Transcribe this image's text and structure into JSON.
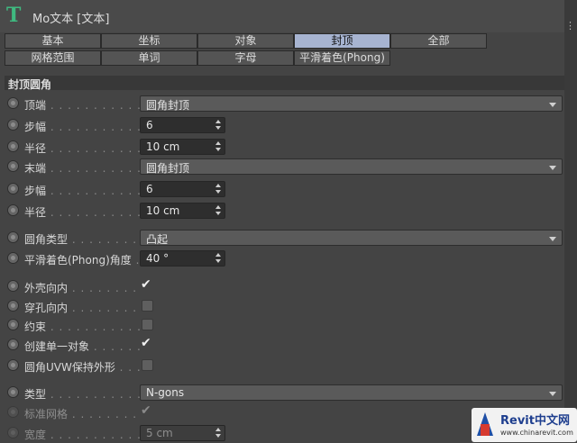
{
  "window": {
    "title": "Mo文本 [文本]",
    "icon": "text-t-icon"
  },
  "tabs_row1": [
    {
      "label": "基本",
      "active": false
    },
    {
      "label": "坐标",
      "active": false
    },
    {
      "label": "对象",
      "active": false
    },
    {
      "label": "封顶",
      "active": true
    },
    {
      "label": "全部",
      "active": false
    }
  ],
  "tabs_row2": [
    {
      "label": "网格范围"
    },
    {
      "label": "单词"
    },
    {
      "label": "字母"
    },
    {
      "label": "平滑着色(Phong)"
    }
  ],
  "section": {
    "title": "封顶圆角"
  },
  "fields": [
    {
      "label": "顶端",
      "type": "dropdown",
      "value": "圆角封顶"
    },
    {
      "label": "步幅",
      "type": "number",
      "value": "6"
    },
    {
      "label": "半径",
      "type": "number",
      "value": "10 cm"
    },
    {
      "label": "末端",
      "type": "dropdown",
      "value": "圆角封顶"
    },
    {
      "label": "步幅",
      "type": "number",
      "value": "6"
    },
    {
      "label": "半径",
      "type": "number",
      "value": "10 cm"
    },
    {
      "label": "圆角类型",
      "type": "dropdown",
      "value": "凸起"
    },
    {
      "label": "平滑着色(Phong)角度",
      "type": "number",
      "value": "40 °"
    },
    {
      "label": "外壳向内",
      "type": "checkbox",
      "checked": true
    },
    {
      "label": "穿孔向内",
      "type": "checkbox",
      "checked": false
    },
    {
      "label": "约束",
      "type": "checkbox",
      "checked": false
    },
    {
      "label": "创建单一对象",
      "type": "checkbox",
      "checked": true
    },
    {
      "label": "圆角UVW保持外形",
      "type": "checkbox",
      "checked": false
    },
    {
      "label": "类型",
      "type": "dropdown",
      "value": "N-gons"
    },
    {
      "label": "标准网格",
      "type": "checkbox",
      "checked": true,
      "disabled": true
    },
    {
      "label": "宽度",
      "type": "number",
      "value": "5 cm",
      "disabled": true
    }
  ],
  "watermark": {
    "title": "Revit中文网",
    "url": "www.chinarevit.com"
  },
  "colors": {
    "active_tab": "#a7b4d1",
    "background": "#444444",
    "icon_green": "#3fb980"
  }
}
